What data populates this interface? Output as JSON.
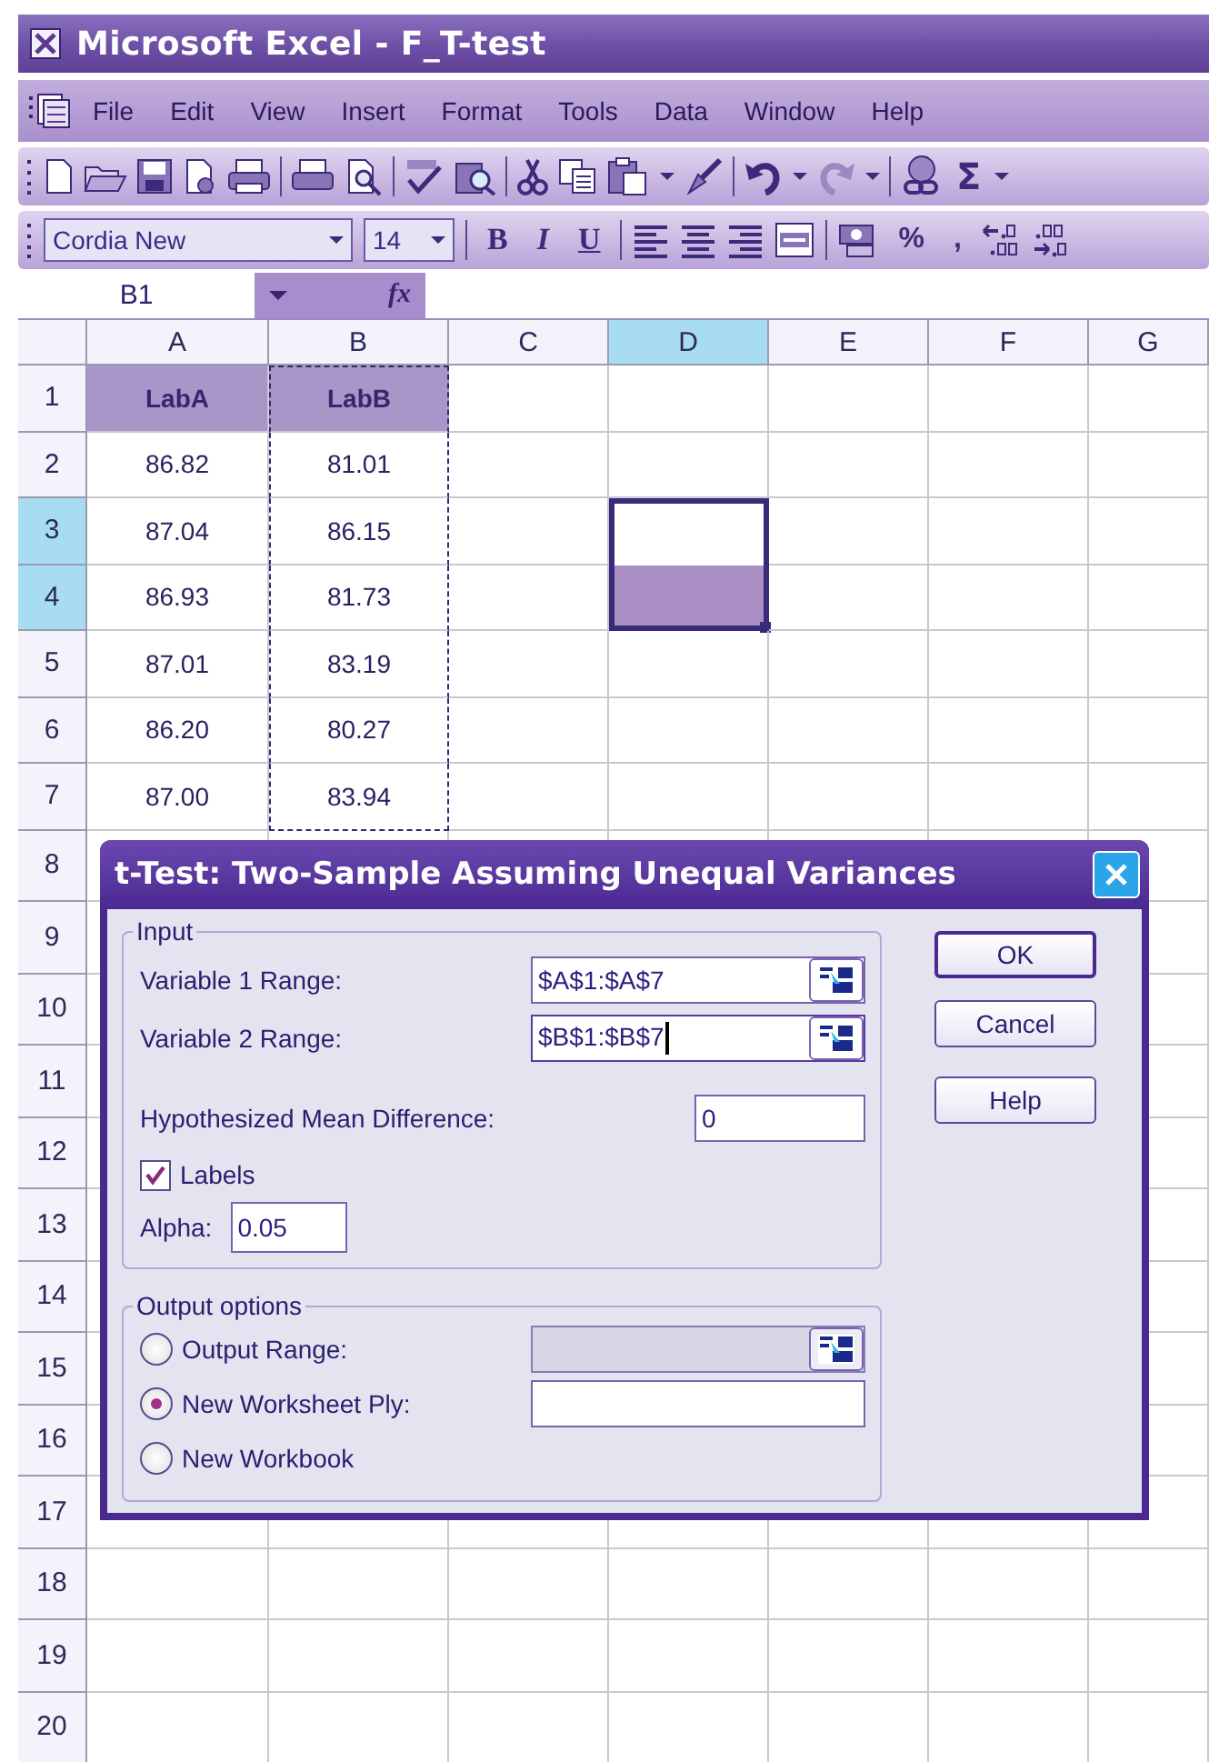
{
  "window": {
    "title": "Microsoft Excel - F_T-test"
  },
  "menu": [
    {
      "label": "File"
    },
    {
      "label": "Edit"
    },
    {
      "label": "View"
    },
    {
      "label": "Insert"
    },
    {
      "label": "Format"
    },
    {
      "label": "Tools"
    },
    {
      "label": "Data"
    },
    {
      "label": "Window"
    },
    {
      "label": "Help"
    }
  ],
  "toolbar": {
    "sum_symbol": "Σ"
  },
  "format_bar": {
    "font": "Cordia New",
    "size": "14",
    "style_buttons": [
      "B",
      "I",
      "U"
    ],
    "percent": "%",
    "comma": ","
  },
  "formula_bar": {
    "name_box": "B1",
    "function_label": "fx"
  },
  "sheet": {
    "columns": [
      {
        "label": "A",
        "selected": false,
        "marquee": false
      },
      {
        "label": "B",
        "selected": false,
        "marquee": true
      },
      {
        "label": "C",
        "selected": false,
        "marquee": false
      },
      {
        "label": "D",
        "selected": true,
        "marquee": false
      },
      {
        "label": "E",
        "selected": false,
        "marquee": false
      },
      {
        "label": "F",
        "selected": false,
        "marquee": false
      },
      {
        "label": "G",
        "selected": false,
        "marquee": false
      }
    ],
    "rows": [
      {
        "label": "1",
        "selected": false,
        "kind": "header",
        "cells": [
          "LabA",
          "LabB"
        ]
      },
      {
        "label": "2",
        "selected": false,
        "kind": "data",
        "cells": [
          "86.82",
          "81.01"
        ]
      },
      {
        "label": "3",
        "selected": true,
        "kind": "data",
        "cells": [
          "87.04",
          "86.15"
        ]
      },
      {
        "label": "4",
        "selected": true,
        "kind": "data",
        "cells": [
          "86.93",
          "81.73"
        ]
      },
      {
        "label": "5",
        "selected": false,
        "kind": "data",
        "cells": [
          "87.01",
          "83.19"
        ]
      },
      {
        "label": "6",
        "selected": false,
        "kind": "data",
        "cells": [
          "86.20",
          "80.27"
        ]
      },
      {
        "label": "7",
        "selected": false,
        "kind": "data",
        "cells": [
          "87.00",
          "83.94"
        ]
      },
      {
        "label": "8",
        "selected": false,
        "kind": "empty"
      },
      {
        "label": "9",
        "selected": false,
        "kind": "empty"
      },
      {
        "label": "10",
        "selected": false,
        "kind": "empty"
      },
      {
        "label": "11",
        "selected": false,
        "kind": "empty"
      },
      {
        "label": "12",
        "selected": false,
        "kind": "empty"
      },
      {
        "label": "13",
        "selected": false,
        "kind": "empty"
      },
      {
        "label": "14",
        "selected": false,
        "kind": "empty"
      },
      {
        "label": "15",
        "selected": false,
        "kind": "empty"
      },
      {
        "label": "16",
        "selected": false,
        "kind": "empty"
      },
      {
        "label": "17",
        "selected": false,
        "kind": "empty"
      },
      {
        "label": "18",
        "selected": false,
        "kind": "empty"
      },
      {
        "label": "19",
        "selected": false,
        "kind": "empty"
      },
      {
        "label": "20",
        "selected": false,
        "kind": "empty"
      }
    ]
  },
  "dialog": {
    "title": "t-Test: Two-Sample Assuming Unequal Variances",
    "input_group": {
      "legend": "Input",
      "fields": [
        {
          "label": "Variable 1 Range:",
          "value": "$A$1:$A$7",
          "kind": "range",
          "focused": false
        },
        {
          "label": "Variable 2 Range:",
          "value": "$B$1:$B$7",
          "kind": "range",
          "focused": true
        },
        {
          "label": "Hypothesized Mean Difference:",
          "value": "0",
          "kind": "number",
          "focused": false
        }
      ],
      "labels_checkbox": {
        "label": "Labels",
        "checked": true
      },
      "alpha": {
        "label": "Alpha:",
        "value": "0.05"
      }
    },
    "output_group": {
      "legend": "Output options",
      "options": [
        {
          "label": "Output Range:",
          "selected": false,
          "kind": "range",
          "disabled": true
        },
        {
          "label": "New Worksheet Ply:",
          "selected": true,
          "kind": "text",
          "disabled": false
        },
        {
          "label": "New Workbook",
          "selected": false,
          "kind": "none",
          "disabled": false
        }
      ]
    },
    "buttons": [
      {
        "label": "OK",
        "default": true
      },
      {
        "label": "Cancel",
        "default": false
      },
      {
        "label": "Help",
        "default": false
      }
    ]
  }
}
